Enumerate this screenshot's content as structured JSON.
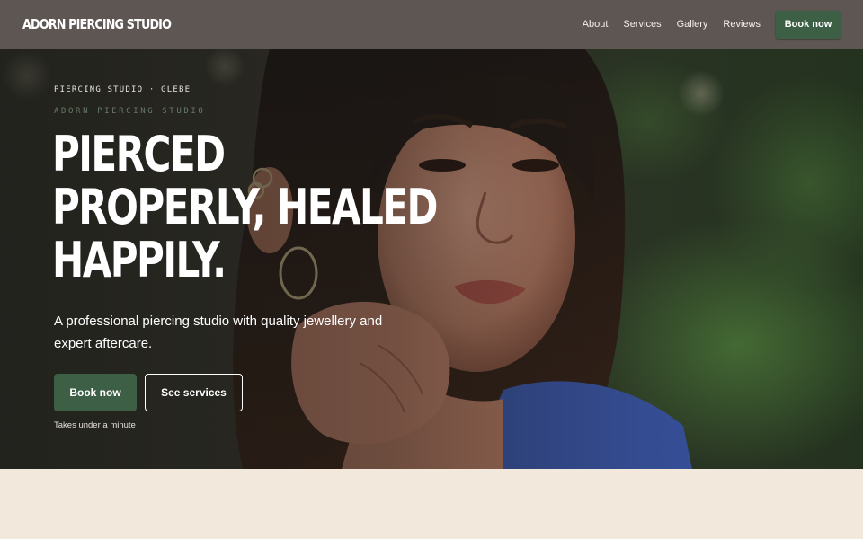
{
  "nav": {
    "brand": "ADORN PIERCING STUDIO",
    "links": [
      "About",
      "Services",
      "Gallery",
      "Reviews"
    ],
    "cta": "Book now"
  },
  "hero": {
    "eyebrow": "PIERCING STUDIO · GLEBE",
    "eyebrow_secondary": "ADORN PIERCING STUDIO",
    "headline_lines": [
      "PIERCED",
      "PROPERLY, HEALED",
      "HAPPILY."
    ],
    "subtitle": "A professional piercing studio with quality jewellery and expert aftercare.",
    "primary_button": "Book now",
    "secondary_button": "See services",
    "note": "Takes under a minute"
  },
  "colors": {
    "nav_bg": "#5e5652",
    "accent": "#3d5f45",
    "page_bg": "#f2e8dc"
  }
}
